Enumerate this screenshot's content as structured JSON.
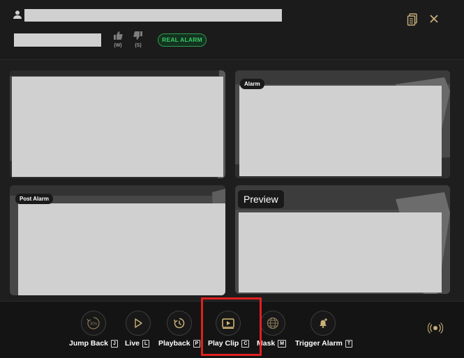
{
  "header": {
    "thumbs_up_key": "(W)",
    "thumbs_down_key": "(S)",
    "badge": "REAL ALARM",
    "icons": {
      "user": "user-icon",
      "document": "document-icon",
      "close": "close-icon"
    }
  },
  "tiles": [
    {
      "label": ""
    },
    {
      "label": "Alarm"
    },
    {
      "label": "Post Alarm"
    },
    {
      "label": "Preview"
    }
  ],
  "controls": [
    {
      "label": "Jump Back",
      "key": "J",
      "icon": "jump-back-30s-icon"
    },
    {
      "label": "Live",
      "key": "L",
      "icon": "play-icon"
    },
    {
      "label": "Playback",
      "key": "P",
      "icon": "history-icon"
    },
    {
      "label": "Play Clip",
      "key": "C",
      "icon": "play-clip-icon"
    },
    {
      "label": "Mask",
      "key": "M",
      "icon": "globe-grid-icon"
    },
    {
      "label": "Trigger Alarm",
      "key": "T",
      "icon": "bell-plus-icon"
    }
  ],
  "colors": {
    "badge": "#38c864",
    "highlight": "#e02020",
    "icon_gold": "#c9b07a"
  }
}
